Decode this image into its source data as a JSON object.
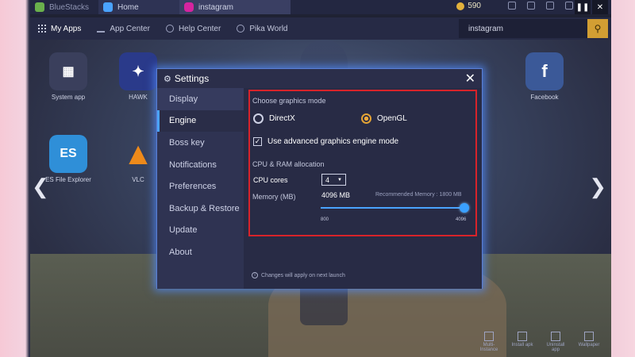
{
  "titlebar": {
    "app_name": "BlueStacks",
    "tabs": [
      {
        "label": "Home"
      },
      {
        "label": "instagram"
      }
    ],
    "coins": "590"
  },
  "navbar": {
    "items": [
      {
        "label": "My Apps"
      },
      {
        "label": "App Center"
      },
      {
        "label": "Help Center"
      },
      {
        "label": "Pika World"
      }
    ],
    "search_value": "instagram"
  },
  "desktop": {
    "icons": [
      {
        "label": "System app",
        "icon": "system-app-icon",
        "color": "#3a3f5c"
      },
      {
        "label": "HAWK",
        "icon": "hawk-icon",
        "color": "#2a3a8a"
      },
      {
        "label": "Facebook",
        "icon": "facebook-icon",
        "color": "#3b5998"
      },
      {
        "label": "ES File Explorer",
        "icon": "es-file-explorer-icon",
        "color": "#2f8fd8"
      },
      {
        "label": "VLC",
        "icon": "vlc-icon",
        "color": "#ee8a1a"
      }
    ],
    "taskbar": [
      {
        "label": "Multi-Instance"
      },
      {
        "label": "Install apk"
      },
      {
        "label": "Uninstall app"
      },
      {
        "label": "Wallpaper"
      }
    ]
  },
  "settings": {
    "title": "Settings",
    "sidebar": [
      {
        "label": "Display"
      },
      {
        "label": "Engine"
      },
      {
        "label": "Boss key"
      },
      {
        "label": "Notifications"
      },
      {
        "label": "Preferences"
      },
      {
        "label": "Backup & Restore"
      },
      {
        "label": "Update"
      },
      {
        "label": "About"
      }
    ],
    "active_item": "Engine",
    "graphics_mode_label": "Choose graphics mode",
    "modes": [
      {
        "label": "DirectX",
        "selected": false
      },
      {
        "label": "OpenGL",
        "selected": true
      }
    ],
    "advanced_label": "Use advanced graphics engine mode",
    "advanced_checked": true,
    "cpu_ram_label": "CPU & RAM allocation",
    "cpu_cores_label": "CPU cores",
    "cpu_cores_value": "4",
    "memory_label": "Memory (MB)",
    "memory_value": "4096 MB",
    "recommended": "Recommended Memory : 1800 MB",
    "slider_min": "800",
    "slider_max": "4096",
    "note": "Changes will apply on next launch"
  },
  "colors": {
    "accent": "#4aa3ff",
    "highlight_box": "#d8232a",
    "radio_selected": "#f2a93a",
    "search_button": "#d29e33"
  }
}
